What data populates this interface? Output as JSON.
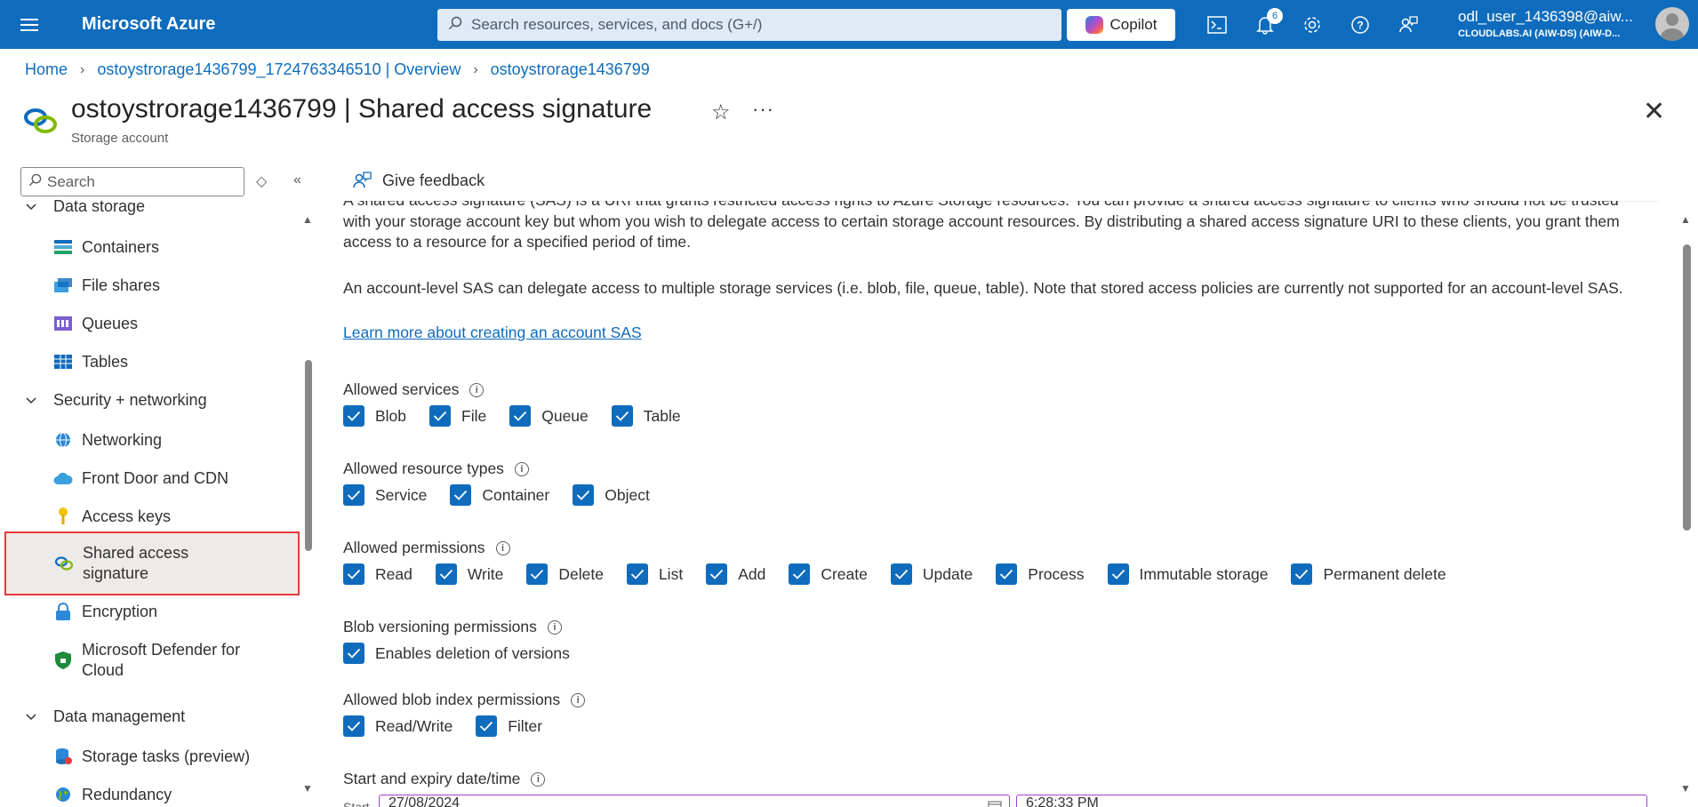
{
  "topbar": {
    "brand": "Microsoft Azure",
    "search_placeholder": "Search resources, services, and docs (G+/)",
    "copilot_label": "Copilot",
    "notification_count": "6",
    "user_name": "odl_user_1436398@aiw...",
    "user_directory": "CLOUDLABS.AI (AIW-DS) (AIW-D..."
  },
  "breadcrumb": [
    "Home",
    "ostoystrorage1436799_1724763346510 | Overview",
    "ostoystrorage1436799"
  ],
  "header": {
    "title": "ostoystrorage1436799 | Shared access signature",
    "subtitle": "Storage account"
  },
  "sidebar": {
    "search_placeholder": "Search",
    "groups": [
      {
        "label": "Data storage",
        "items": [
          "Containers",
          "File shares",
          "Queues",
          "Tables"
        ]
      },
      {
        "label": "Security + networking",
        "items": [
          "Networking",
          "Front Door and CDN",
          "Access keys",
          "Shared access signature",
          "Encryption",
          "Microsoft Defender for Cloud"
        ]
      },
      {
        "label": "Data management",
        "items": [
          "Storage tasks (preview)",
          "Redundancy"
        ]
      }
    ],
    "selected": "Shared access signature"
  },
  "toolbar": {
    "feedback_label": "Give feedback"
  },
  "main": {
    "intro_partial": "A shared access signature (SAS) is a URI that grants restricted access rights to Azure Storage resources. You can provide a shared access signature to clients who should not be trusted with your storage account key but whom you wish to delegate access to certain storage account resources. By distributing a shared access signature URI to these clients, you grant them access to a resource for a specified period of time.",
    "account_level": "An account-level SAS can delegate access to multiple storage services (i.e. blob, file, queue, table). Note that stored access policies are currently not supported for an account-level SAS.",
    "learn_more": "Learn more about creating an account SAS",
    "allowed_services": {
      "label": "Allowed services",
      "options": [
        "Blob",
        "File",
        "Queue",
        "Table"
      ]
    },
    "allowed_resource_types": {
      "label": "Allowed resource types",
      "options": [
        "Service",
        "Container",
        "Object"
      ]
    },
    "allowed_permissions": {
      "label": "Allowed permissions",
      "options": [
        "Read",
        "Write",
        "Delete",
        "List",
        "Add",
        "Create",
        "Update",
        "Process",
        "Immutable storage",
        "Permanent delete"
      ]
    },
    "blob_versioning": {
      "label": "Blob versioning permissions",
      "options": [
        "Enables deletion of versions"
      ]
    },
    "blob_index": {
      "label": "Allowed blob index permissions",
      "options": [
        "Read/Write",
        "Filter"
      ]
    },
    "start_expiry": {
      "label": "Start and expiry date/time",
      "start_label": "Start",
      "start_date": "27/08/2024",
      "start_time": "6:28:33 PM"
    }
  },
  "colors": {
    "accent": "#0f6cbd",
    "selection_border": "#e8393a"
  }
}
